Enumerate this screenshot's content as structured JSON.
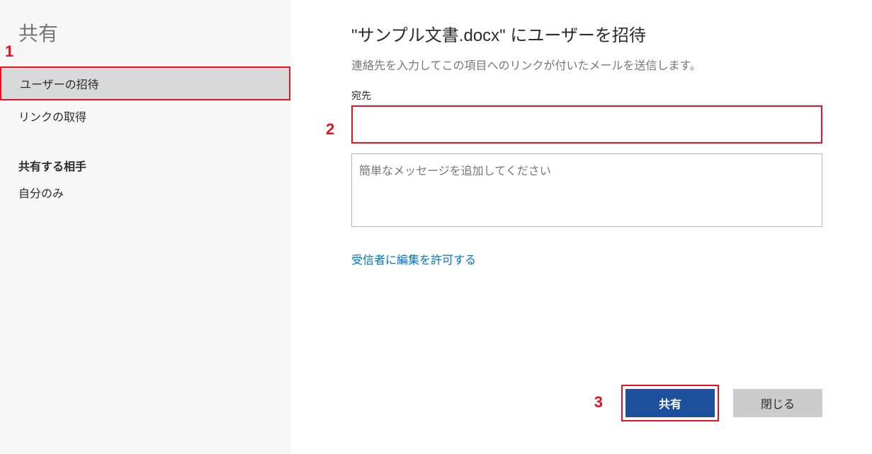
{
  "sidebar": {
    "title": "共有",
    "items": [
      {
        "label": "ユーザーの招待",
        "selected": true
      },
      {
        "label": "リンクの取得",
        "selected": false
      }
    ],
    "section_label": "共有する相手",
    "shared_with": [
      {
        "label": "自分のみ"
      }
    ]
  },
  "main": {
    "title": "\"サンプル文書.docx\" にユーザーを招待",
    "subtitle": "連絡先を入力してこの項目へのリンクが付いたメールを送信します。",
    "recipient_label": "宛先",
    "recipient_value": "",
    "message_placeholder": "簡単なメッセージを追加してください",
    "message_value": "",
    "permission_link": "受信者に編集を許可する",
    "share_button": "共有",
    "close_button": "閉じる"
  },
  "annotations": {
    "a1": "1",
    "a2": "2",
    "a3": "3"
  }
}
